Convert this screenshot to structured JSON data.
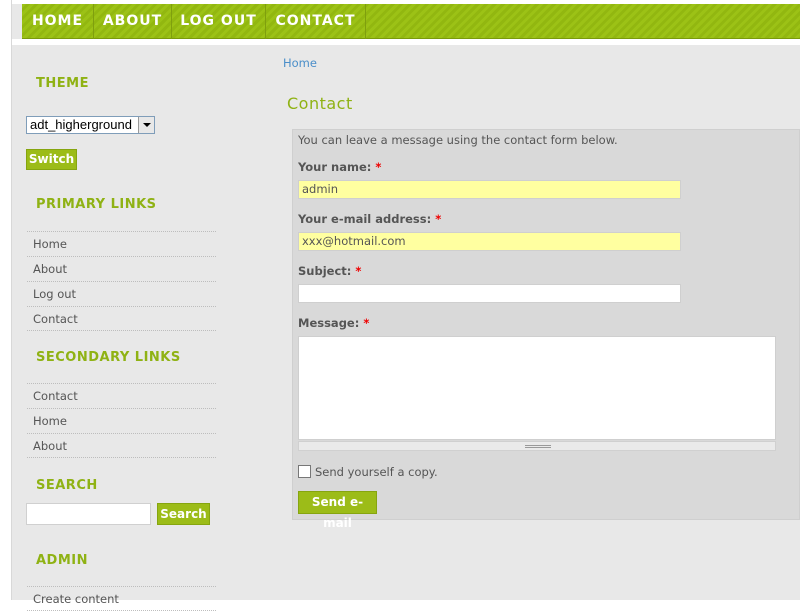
{
  "nav": {
    "items": [
      "HOME",
      "ABOUT",
      "LOG OUT",
      "CONTACT"
    ]
  },
  "sidebar": {
    "theme": {
      "title": "THEME",
      "selected": "adt_higherground",
      "switch_label": "Switch"
    },
    "primary_links": {
      "title": "PRIMARY LINKS",
      "items": [
        "Home",
        "About",
        "Log out",
        "Contact"
      ]
    },
    "secondary_links": {
      "title": "SECONDARY LINKS",
      "items": [
        "Contact",
        "Home",
        "About"
      ]
    },
    "search": {
      "title": "SEARCH",
      "button_label": "Search",
      "value": ""
    },
    "admin": {
      "title": "ADMIN",
      "items": [
        "Create content"
      ]
    }
  },
  "main": {
    "breadcrumb": "Home",
    "title": "Contact",
    "intro": "You can leave a message using the contact form below.",
    "fields": {
      "name_label": "Your name:",
      "name_value": "admin",
      "email_label": "Your e-mail address:",
      "email_value": "xxx@hotmail.com",
      "subject_label": "Subject:",
      "subject_value": "",
      "message_label": "Message:",
      "required_mark": "*"
    },
    "copy_label": "Send yourself a copy.",
    "submit_label": "Send e-mail"
  },
  "colors": {
    "accent_green": "#9cbc18",
    "title_green": "#8fb214",
    "link_blue": "#4a8ec9",
    "field_yellow": "#ffffa0",
    "required_red": "#e00000"
  }
}
